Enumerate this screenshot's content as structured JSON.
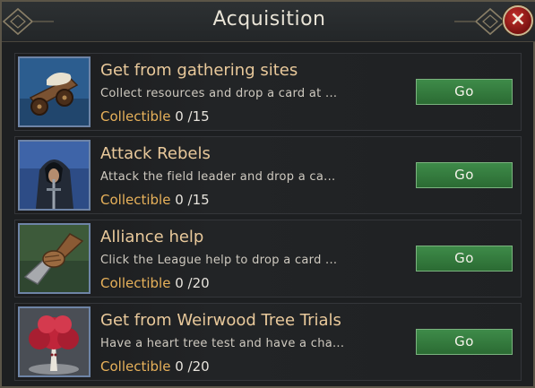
{
  "window": {
    "title": "Acquisition",
    "close_icon": "×"
  },
  "rows": [
    {
      "title": "Get from gathering sites",
      "desc": "Collect resources and drop a card at ...",
      "collect_label": "Collectible",
      "count": " 0 /15",
      "button": "Go",
      "icon": "resource-cart-icon"
    },
    {
      "title": "Attack Rebels",
      "desc": "Attack the field leader and drop a ca...",
      "collect_label": "Collectible",
      "count": " 0 /15",
      "button": "Go",
      "icon": "hooded-warrior-icon"
    },
    {
      "title": "Alliance help",
      "desc": "Click the League help to drop a card ...",
      "collect_label": "Collectible",
      "count": " 0 /20",
      "button": "Go",
      "icon": "handshake-icon"
    },
    {
      "title": "Get from Weirwood Tree Trials",
      "desc": "Have a heart tree test and have a cha...",
      "collect_label": "Collectible",
      "count": " 0 /20",
      "button": "Go",
      "icon": "weirwood-tree-icon"
    }
  ],
  "colors": {
    "title_text": "#e9c99b",
    "collect_label": "#e7b15a",
    "button_green": "#3e8b49",
    "close_red": "#c4302a"
  }
}
